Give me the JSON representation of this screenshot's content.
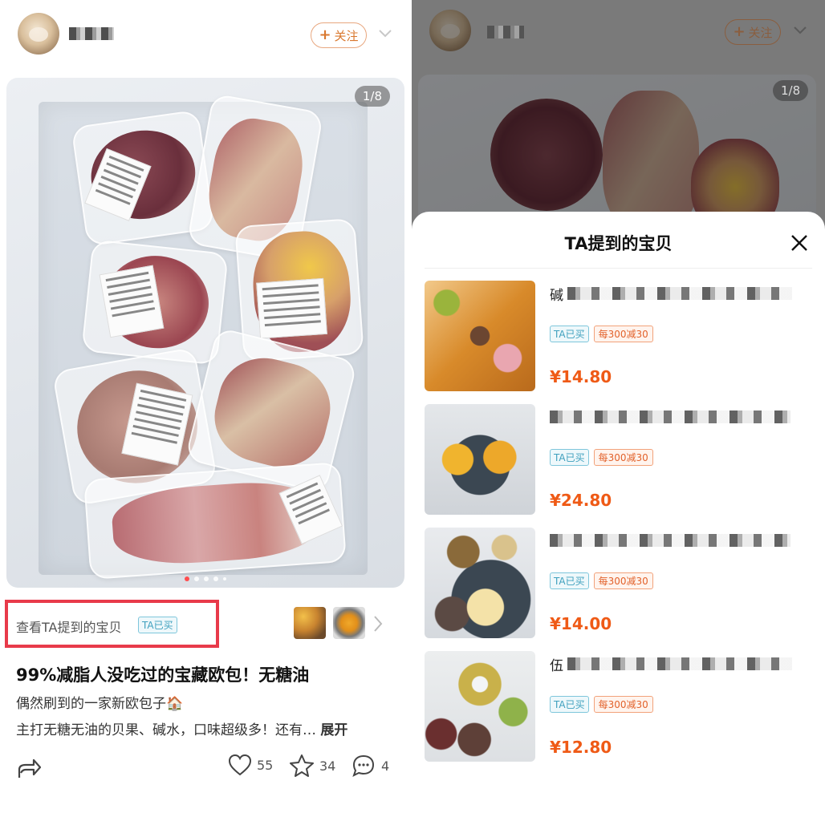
{
  "left": {
    "follow_label": "关注",
    "image_counter": "1/8",
    "mention_text": "查看TA提到的宝贝",
    "mention_tag": "TA已买",
    "title": "99%减脂人没吃过的宝藏欧包！无糖油",
    "line1": "偶然刷到的一家新欧包子🏠",
    "line2_text": "主打无糖无油的贝果、碱水，口味超级多！还有…",
    "line2_expand": "展开",
    "likes": "55",
    "stars": "34",
    "comments": "4",
    "page_dots": 5,
    "active_dot": 0
  },
  "right": {
    "follow_label": "关注",
    "image_counter": "1/8",
    "sheet_title": "TA提到的宝贝",
    "products": [
      {
        "name_prefix": "碱",
        "tag_bought": "TA已买",
        "tag_promo": "每300减30",
        "price": "¥14.80"
      },
      {
        "name_prefix": "",
        "tag_bought": "TA已买",
        "tag_promo": "每300减30",
        "price": "¥24.80"
      },
      {
        "name_prefix": "",
        "tag_bought": "TA已买",
        "tag_promo": "每300减30",
        "price": "¥14.00"
      },
      {
        "name_prefix": "伍",
        "tag_bought": "TA已买",
        "tag_promo": "每300减30",
        "price": "¥12.80"
      }
    ]
  },
  "colors": {
    "accent_orange": "#ef5a16",
    "highlight_red": "#e83a4a",
    "tag_blue": "#3fa0be"
  }
}
